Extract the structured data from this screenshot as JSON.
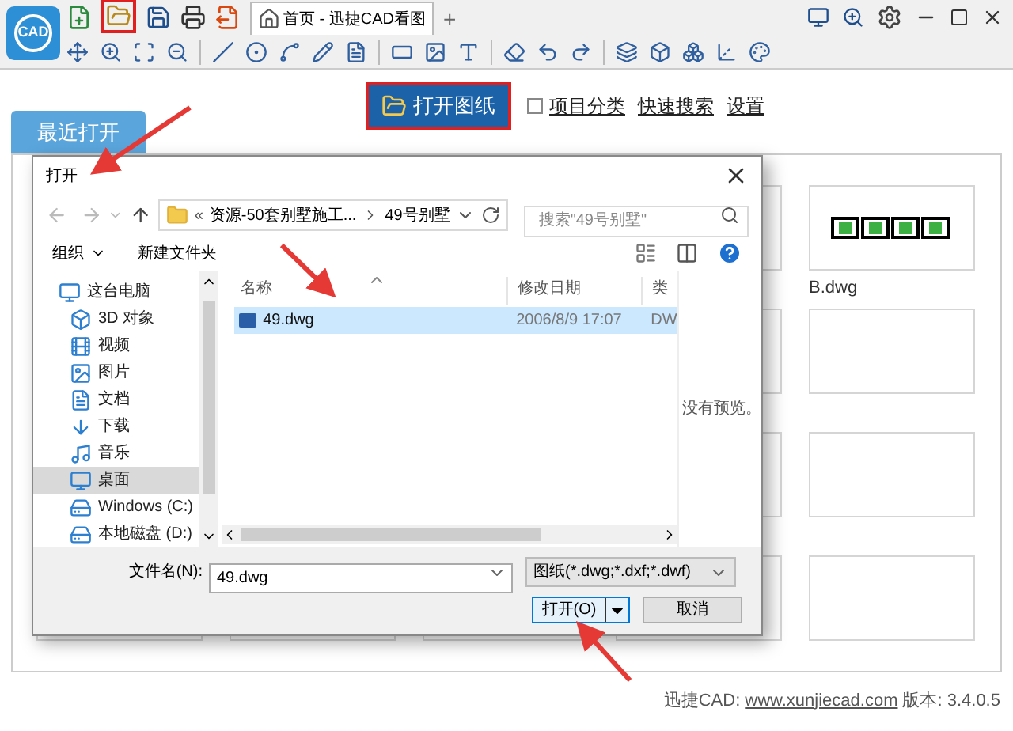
{
  "app": {
    "logo_text": "CAD",
    "tabs": [
      {
        "label": "首页 - 迅捷CAD看图",
        "selected": true
      }
    ],
    "new_tab": "+"
  },
  "home": {
    "open_button": "打开图纸",
    "project_checkbox": {
      "label": "项目分类",
      "checked": false
    },
    "links": [
      "快速搜索",
      "设置"
    ],
    "recent_tab": {
      "label": "最近打开",
      "selected": true
    },
    "recent_files": [
      {
        "name": "B.dwg"
      }
    ]
  },
  "dialog": {
    "title": "打开",
    "address": {
      "prefix": "«",
      "segments": [
        "资源-50套别墅施工...",
        "49号别墅"
      ]
    },
    "search": {
      "placeholder": "搜索\"49号别墅\""
    },
    "toolbar": [
      "组织",
      "新建文件夹"
    ],
    "nav": [
      {
        "label": "这台电脑",
        "selected": false,
        "children": [
          {
            "label": "3D 对象",
            "selected": false
          },
          {
            "label": "视频",
            "selected": false
          },
          {
            "label": "图片",
            "selected": false
          },
          {
            "label": "文档",
            "selected": false
          },
          {
            "label": "下载",
            "selected": false
          },
          {
            "label": "音乐",
            "selected": false
          },
          {
            "label": "桌面",
            "selected": true
          },
          {
            "label": "Windows (C:)",
            "selected": false
          },
          {
            "label": "本地磁盘 (D:)",
            "selected": false
          }
        ]
      }
    ],
    "columns": [
      "名称",
      "修改日期",
      "类"
    ],
    "files": [
      {
        "name": "49.dwg",
        "modified": "2006/8/9 17:07",
        "type": "DW",
        "selected": true
      }
    ],
    "preview_text": "没有预览。",
    "filename_label": "文件名(N):",
    "filename": "49.dwg",
    "filter": "图纸(*.dwg;*.dxf;*.dwf)",
    "open_button": "打开(O)",
    "cancel_button": "取消"
  },
  "footer": {
    "label": "迅捷CAD:",
    "link": "www.xunjiecad.com",
    "version": "版本: 3.4.0.5"
  }
}
